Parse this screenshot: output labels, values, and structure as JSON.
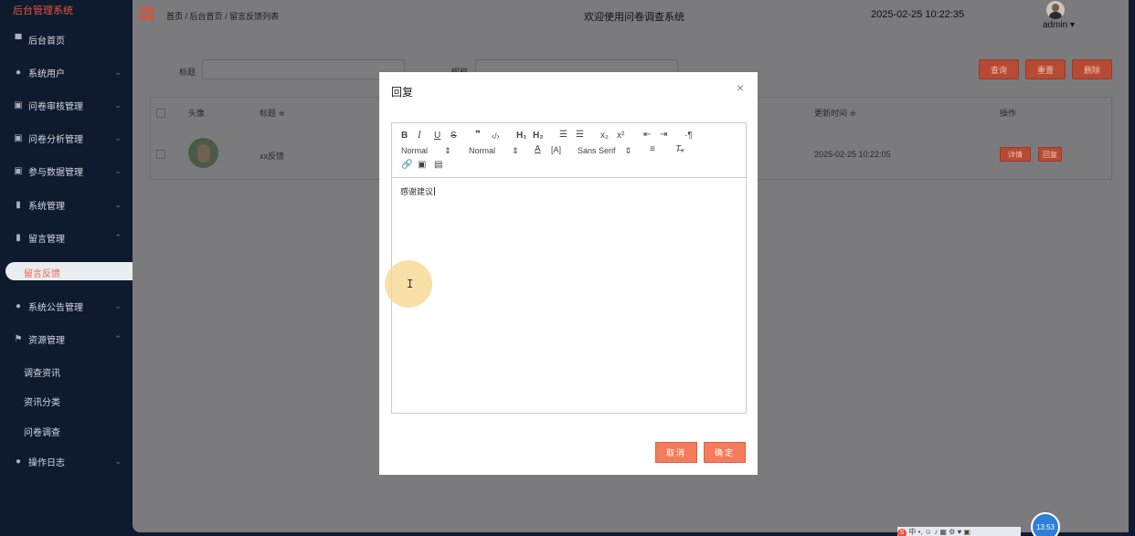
{
  "sidebar": {
    "brand": "后台管理系统",
    "items": [
      {
        "label": "后台首页",
        "icon": "monitor-icon"
      },
      {
        "label": "系统用户",
        "icon": "user-icon"
      },
      {
        "label": "问卷审核管理",
        "icon": "list-icon"
      },
      {
        "label": "问卷分析管理",
        "icon": "list-icon"
      },
      {
        "label": "参与数据管理",
        "icon": "list-icon"
      },
      {
        "label": "系统管理",
        "icon": "chart-icon"
      },
      {
        "label": "留言管理",
        "icon": "chart-icon"
      },
      {
        "label": "系统公告管理",
        "icon": "info-icon"
      },
      {
        "label": "资源管理",
        "icon": "flag-icon"
      },
      {
        "label": "操作日志",
        "icon": "user-icon"
      }
    ],
    "active_sub": "留言反馈",
    "resource_subs": [
      "调查资讯",
      "资讯分类",
      "问卷调查"
    ]
  },
  "header": {
    "breadcrumb": [
      "首页",
      "后台首页",
      "留言反馈列表"
    ],
    "welcome": "欢迎使用问卷调查系统",
    "datetime": "2025-02-25 10:22:35",
    "user": "admin"
  },
  "search": {
    "title_label": "标题",
    "nickname_label": "昵称",
    "query_btn": "查询",
    "reset_btn": "重置",
    "delete_btn": "删除"
  },
  "table": {
    "columns": [
      "头像",
      "标题 ≑",
      "更新时间 ≑",
      "操作"
    ],
    "rows": [
      {
        "title": "xx反馈",
        "updated": "2025-02-25 10:22:05",
        "detail_btn": "详情",
        "reply_btn": "回复"
      }
    ]
  },
  "modal": {
    "title": "回复",
    "close": "×",
    "toolbar": {
      "header_select": "Normal",
      "size_select": "Normal",
      "font_select": "Sans Serif",
      "h1": "H₁",
      "h2": "H₂",
      "sub": "x₂",
      "sup": "x²"
    },
    "content": "感谢建议",
    "cancel": "取消",
    "confirm": "确定"
  },
  "taskbar": {
    "time": "13:53",
    "ime": "中"
  }
}
